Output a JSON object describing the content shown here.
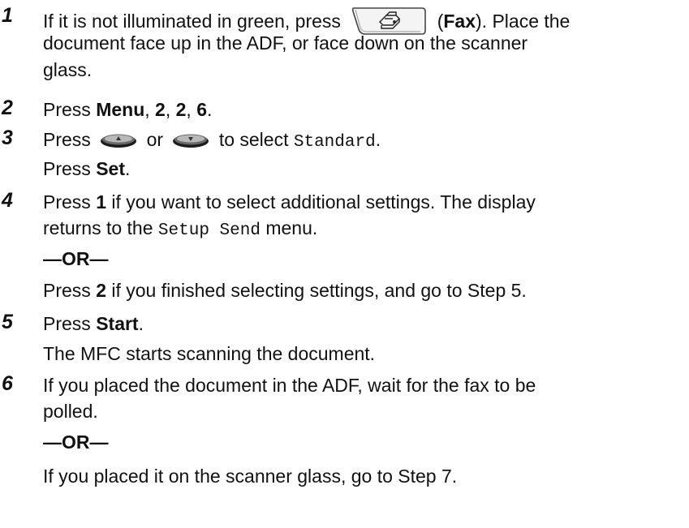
{
  "steps": [
    {
      "number": "1",
      "line1_pre": "If it is not illuminated in green, press",
      "key_label_open": "(",
      "key_label": "Fax",
      "key_label_close": ").",
      "line1_post": " Place the",
      "line2": "document face up in the ADF, or face down on the scanner",
      "line3": "glass.",
      "fax_key_icon": "fax-machine-icon"
    },
    {
      "number": "2",
      "pre": "Press ",
      "menu": "Menu",
      "sep1": ", ",
      "k1": "2",
      "sep2": ", ",
      "k2": "2",
      "sep3": ", ",
      "k3": "6",
      "end": "."
    },
    {
      "number": "3",
      "pre": "Press",
      "or": "or",
      "to_select": "to select",
      "option": "Standard",
      "end": ".",
      "press": "Press ",
      "set": "Set",
      "set_end": ".",
      "up_icon": "up-arrow-key-icon",
      "down_icon": "down-arrow-key-icon"
    },
    {
      "number": "4",
      "pre": "Press ",
      "k1": "1",
      "line1_post": " if you want to select additional settings. The display",
      "line2_pre": "returns to the ",
      "menu_name": "Setup Send",
      "line2_post": " menu.",
      "or_label": "—OR—",
      "alt_pre": "Press ",
      "k2": "2",
      "alt_post": " if you finished selecting settings, and go to Step 5."
    },
    {
      "number": "5",
      "pre": "Press ",
      "start": "Start",
      "end": ".",
      "line2": "The MFC starts scanning the document."
    },
    {
      "number": "6",
      "line1": "If you placed the document in the ADF, wait for the fax to be",
      "line2": "polled.",
      "or_label": "—OR—",
      "line3": "If you placed it on the scanner glass, go to Step 7."
    }
  ]
}
